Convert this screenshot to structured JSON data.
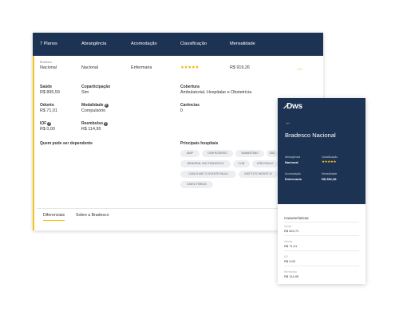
{
  "table_header": {
    "plans": "7 Planos",
    "coverage": "Abrangência",
    "accommodation": "Acomodação",
    "rating": "Classificação",
    "monthly": "Mensalidade"
  },
  "plan": {
    "operator": "Bradesco",
    "name": "Nacional",
    "coverage": "Nacional",
    "accommodation": "Enfermaria",
    "rating_stars": "★★★★★",
    "price": "R$ 919,26",
    "expanded_icon": "chevron-up-icon"
  },
  "details": {
    "health_label": "Saúde",
    "health_value": "R$ 895,59",
    "copay_label": "Coparticipação",
    "copay_value": "Sim",
    "dental_label": "Odonto",
    "dental_value": "R$ 71,01",
    "modality_label": "Modalidade",
    "modality_value": "Compulsório",
    "iof_label": "IOF",
    "iof_value": "R$ 0,00",
    "refund_label": "Reembolso",
    "refund_value": "R$ 114,95",
    "dependents_label": "Quem pode ser dependente",
    "cover_label": "Cobertura",
    "cover_value": "Ambulatorial, Hospitalar e Obstetrícia",
    "grace_label": "Carências",
    "grace_value": "0",
    "hospitals_label": "Principais hospitais"
  },
  "hospitals": [
    "AMIP",
    "DOM RODRIGO",
    "SAMARITANO",
    "SAO",
    "MEMORIAL SAO FRANCISCO",
    "CLIM",
    "JOÃO PAULO",
    "CASA S MAT O VICENTE PAULA",
    "INSTITUTO MONTE SI",
    "SANTA TEREZA"
  ],
  "tabs": [
    "Diferenciais",
    "Sobre a Bradesco"
  ],
  "mobile": {
    "logo": "Dws",
    "title": "Bradesco Nacional",
    "coverage_label": "Abrangência",
    "coverage_value": "Nacional",
    "rating_label": "Classificação",
    "rating_stars": "★★★★★",
    "accommodation_label": "Acomodação",
    "accommodation_value": "Enfermaria",
    "monthly_label": "Mensalidade",
    "monthly_value": "R$ 552,38",
    "section_title": "Características",
    "rows": [
      {
        "label": "Saúde",
        "value": "R$ 824,71"
      },
      {
        "label": "Odonto",
        "value": "R$ 71,01"
      },
      {
        "label": "IOF",
        "value": "R$ 0,00"
      },
      {
        "label": "Reembolso",
        "value": "R$ 114,95"
      }
    ]
  },
  "colors": {
    "navy": "#1d3353",
    "accent": "#f5c518"
  }
}
